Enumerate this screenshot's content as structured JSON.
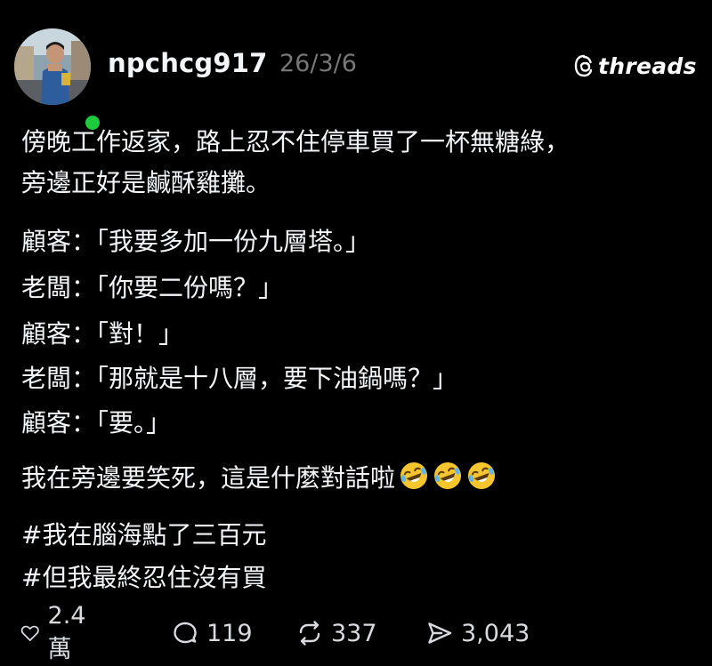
{
  "post": {
    "username": "npchcg917",
    "date": "26/3/6",
    "brand": "threads",
    "lines": [
      "傍晚工作返家，路上忍不住停車買了一杯無糖綠，",
      "旁邊正好是鹹酥雞攤。",
      "顧客：「我要多加一份九層塔。」",
      "老闆：「你要二份嗎？」",
      "顧客：「對！」",
      "老闆：「那就是十八層，要下油鍋嗎？」",
      "顧客：「要。」",
      "我在旁邊要笑死，這是什麼對話啦",
      "#我在腦海點了三百元",
      "#但我最終忍住沒有買"
    ],
    "emoji_name": "rolling-on-the-floor-laughing",
    "emoji_count": 3
  },
  "actions": {
    "likes": "2.4萬",
    "replies": "119",
    "reposts": "337",
    "shares": "3,043"
  },
  "colors": {
    "background": "#000000",
    "text": "#f3f5f7",
    "muted": "#777777",
    "online": "#1ecb3f"
  }
}
